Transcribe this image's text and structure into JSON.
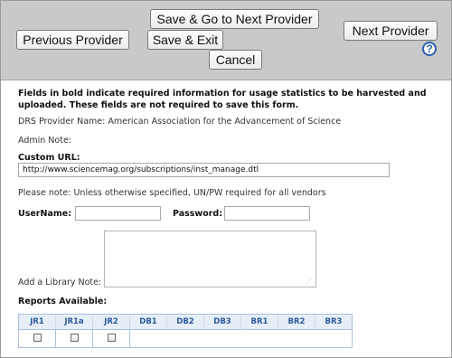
{
  "toolbar": {
    "previous_label": "Previous Provider",
    "save_next_label": "Save & Go to Next Provider",
    "save_exit_label": "Save & Exit",
    "cancel_label": "Cancel",
    "next_label": "Next Provider",
    "help_icon": "?"
  },
  "form": {
    "intro_text_line1": "Fields in bold indicate required information for usage statistics to be harvested and",
    "intro_text_line2": "uploaded. These fields are not required to save this form.",
    "provider_name": "DRS Provider Name: American Association for the Advancement of Science",
    "admin_note_label": "Admin Note:",
    "custom_url_label": "Custom URL:",
    "custom_url_value": "http://www.sciencemag.org/subscriptions/inst_manage.dtl",
    "note_text": "Please note: Unless otherwise specified, UN/PW required for all vendors",
    "username_label": "UserName:",
    "username_value": "",
    "password_label": "Password:",
    "password_value": "",
    "library_note_label": "Add a Library Note:",
    "reports_label": "Reports Available:"
  },
  "reports": {
    "columns": [
      "JR1",
      "JR1a",
      "JR2",
      "DB1",
      "DB2",
      "DB3",
      "BR1",
      "BR2",
      "BR3"
    ],
    "checkbox_columns": [
      "JR1",
      "JR1a",
      "JR2"
    ],
    "checked": [
      false,
      false,
      false
    ]
  }
}
